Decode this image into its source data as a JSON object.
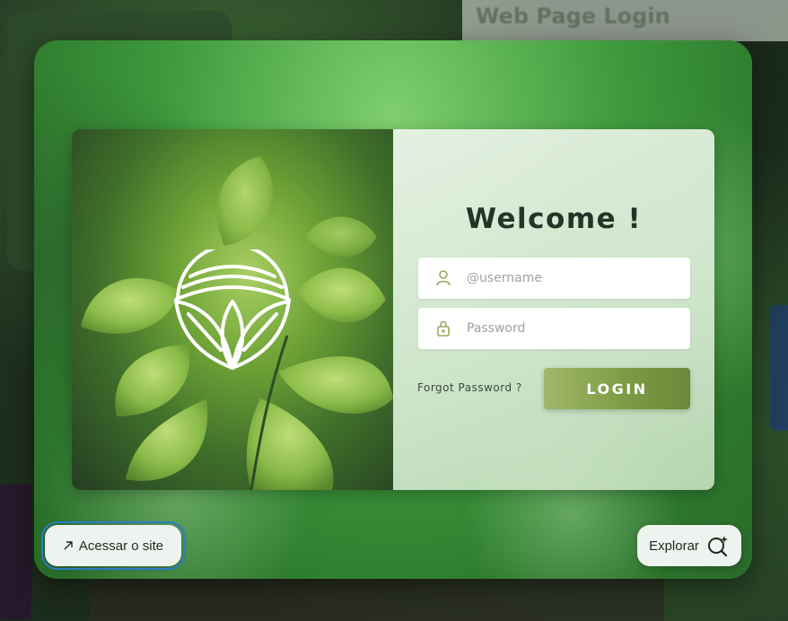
{
  "background": {
    "page_title": "Web Page Login"
  },
  "login": {
    "welcome_title": "Welcome !",
    "username_placeholder": "@username",
    "password_placeholder": "Password",
    "forgot_password": "Forgot Password ?",
    "login_button": "LOGIN"
  },
  "icons": {
    "username": "user-icon",
    "password": "lock-icon",
    "logo": "leaf-logo",
    "access": "arrow-up-right-icon",
    "explore": "search-sparkle-icon"
  },
  "actions": {
    "access_label": "Acessar o site",
    "explore_label": "Explorar"
  },
  "colors": {
    "accent_green": "#7e9c45",
    "focus_outline": "#2a7dc7"
  }
}
